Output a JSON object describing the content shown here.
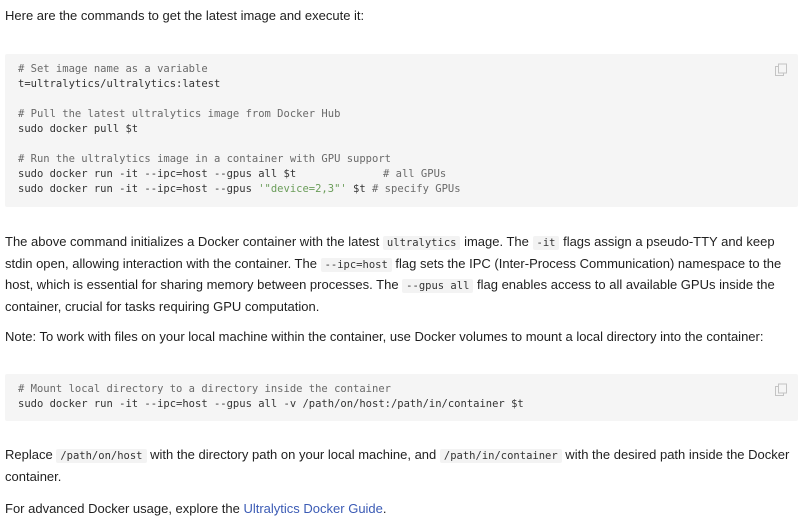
{
  "intro": "Here are the commands to get the latest image and execute it:",
  "code_block_1": {
    "c1": "# Set image name as a variable",
    "l1": "t=ultralytics/ultralytics:latest",
    "c2": "# Pull the latest ultralytics image from Docker Hub",
    "l2": "sudo docker pull $t",
    "c3": "# Run the ultralytics image in a container with GPU support",
    "l3a": "sudo docker run -it --ipc=host --gpus all $t",
    "l3a_comment": "# all GPUs",
    "l3b_pre": "sudo docker run -it --ipc=host --gpus ",
    "l3b_str": "'\"device=2,3\"'",
    "l3b_post": " $t ",
    "l3b_comment": "# specify GPUs"
  },
  "para2": {
    "t1": "The above command initializes a Docker container with the latest ",
    "code1": "ultralytics",
    "t2": " image. The ",
    "code2": "-it",
    "t3": " flags assign a pseudo-TTY and keep stdin open, allowing interaction with the container. The ",
    "code3": "--ipc=host",
    "t4": " flag sets the IPC (Inter-Process Communication) namespace to the host, which is essential for sharing memory between processes. The ",
    "code4": "--gpus all",
    "t5": " flag enables access to all available GPUs inside the container, crucial for tasks requiring GPU computation."
  },
  "note": "Note: To work with files on your local machine within the container, use Docker volumes to mount a local directory into the container:",
  "code_block_2": {
    "c1": "# Mount local directory to a directory inside the container",
    "l1": "sudo docker run -it --ipc=host --gpus all -v /path/on/host:/path/in/container $t"
  },
  "para4": {
    "t1": "Replace ",
    "code1": "/path/on/host",
    "t2": " with the directory path on your local machine, and ",
    "code2": "/path/in/container",
    "t3": " with the desired path inside the Docker container."
  },
  "para5": {
    "t1": "For advanced Docker usage, explore the ",
    "link": "Ultralytics Docker Guide",
    "t2": "."
  },
  "icons": {
    "copy": "copy-icon"
  },
  "colors": {
    "link": "#3b5bb5",
    "code_bg": "#f5f5f5",
    "string": "#6b9d5a"
  }
}
